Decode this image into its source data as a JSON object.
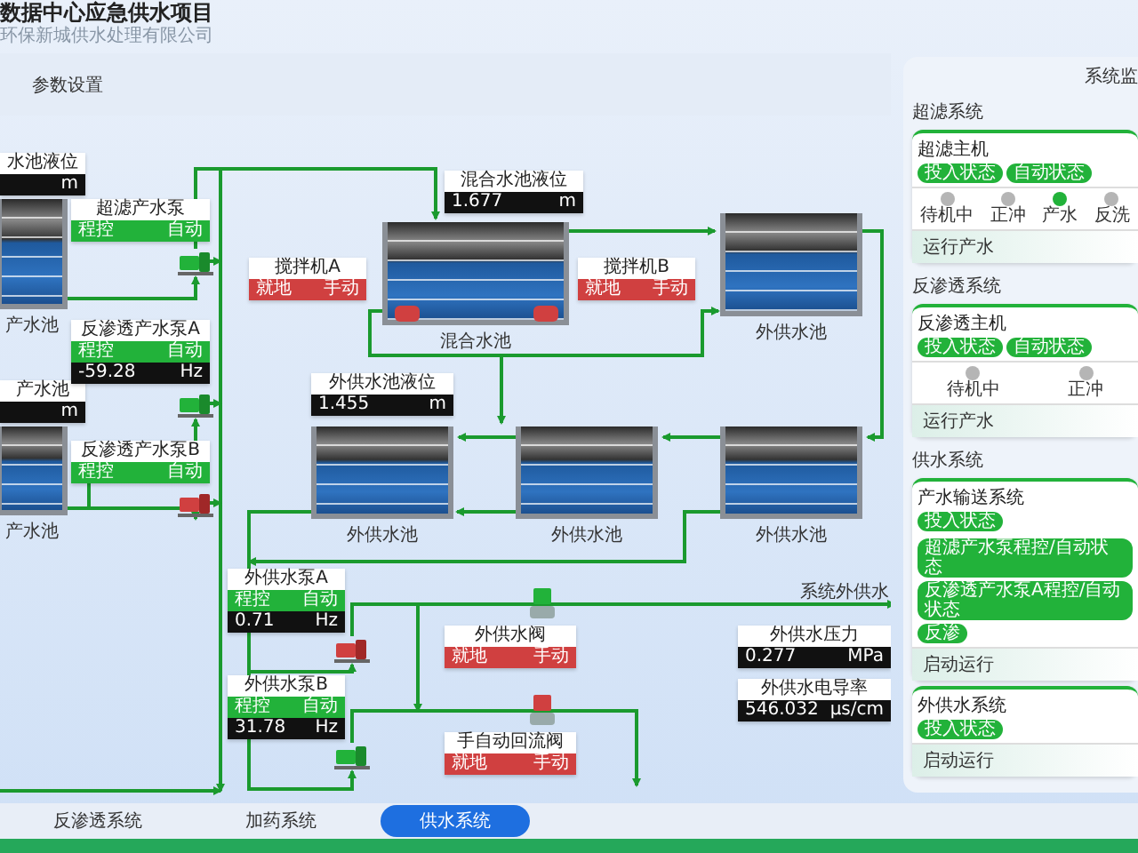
{
  "header": {
    "title": "数据中心应急供水项目",
    "subtitle": "环保新城供水处理有限公司"
  },
  "toolbar": {
    "label": "参数设置"
  },
  "diagram": {
    "tanks": [
      {
        "caption": "产水池"
      },
      {
        "caption": "混合水池"
      },
      {
        "caption": "外供水池"
      },
      {
        "caption": "产水池"
      },
      {
        "caption": "外供水池"
      },
      {
        "caption": "外供水池"
      },
      {
        "caption": "外供水池"
      }
    ],
    "level_gauges": [
      {
        "title": "水池液位",
        "unit": "m"
      },
      {
        "title": "产水池",
        "unit": "m"
      },
      {
        "title": "混合水池液位",
        "value": "1.677",
        "unit": "m"
      },
      {
        "title": "外供水池液位",
        "value": "1.455",
        "unit": "m"
      }
    ],
    "pumps": [
      {
        "title": "超滤产水泵",
        "mode": "程控",
        "control": "自动",
        "remote": true,
        "running": true
      },
      {
        "title": "反渗透产水泵A",
        "mode": "程控",
        "control": "自动",
        "remote": true,
        "reading": "-59.28",
        "unit": "Hz",
        "running": true
      },
      {
        "title": "反渗透产水泵B",
        "mode": "程控",
        "control": "自动",
        "remote": true,
        "running": false
      },
      {
        "title": "外供水泵A",
        "mode": "程控",
        "control": "自动",
        "remote": true,
        "reading": "0.71",
        "unit": "Hz",
        "running": false
      },
      {
        "title": "外供水泵B",
        "mode": "程控",
        "control": "自动",
        "remote": true,
        "reading": "31.78",
        "unit": "Hz",
        "running": true
      }
    ],
    "mixers": [
      {
        "title": "搅拌机A",
        "mode": "就地",
        "control": "手动",
        "remote": false,
        "running": false
      },
      {
        "title": "搅拌机B",
        "mode": "就地",
        "control": "手动",
        "remote": false,
        "running": false
      }
    ],
    "valves": [
      {
        "title": "外供水阀",
        "mode": "就地",
        "control": "手动",
        "remote": false,
        "open": true
      },
      {
        "title": "手自动回流阀",
        "mode": "就地",
        "control": "手动",
        "remote": false,
        "open": false
      }
    ],
    "outlet_label": "系统外供水",
    "instruments": [
      {
        "title": "外供水压力",
        "value": "0.277",
        "unit": "MPa"
      },
      {
        "title": "外供水电导率",
        "value": "546.032",
        "unit": "μs/cm"
      }
    ]
  },
  "tabs": [
    {
      "label": "反渗透系统",
      "selected": false
    },
    {
      "label": "加药系统",
      "selected": false
    },
    {
      "label": "供水系统",
      "selected": true
    }
  ],
  "panel": {
    "title": "系统监",
    "sections": [
      {
        "heading": "超滤系统",
        "cards": [
          {
            "title": "超滤主机",
            "pills": [
              "投入状态",
              "自动状态"
            ],
            "steps": [
              {
                "label": "待机中",
                "selected": false
              },
              {
                "label": "正冲",
                "selected": false
              },
              {
                "label": "产水",
                "selected": true
              },
              {
                "label": "反洗",
                "selected": false
              }
            ],
            "status": "运行产水"
          }
        ]
      },
      {
        "heading": "反渗透系统",
        "cards": [
          {
            "title": "反渗透主机",
            "pills": [
              "投入状态",
              "自动状态"
            ],
            "steps": [
              {
                "label": "待机中",
                "selected": false
              },
              {
                "label": "正冲",
                "selected": false
              }
            ],
            "status": "运行产水"
          }
        ]
      },
      {
        "heading": "供水系统",
        "cards": [
          {
            "title": "产水输送系统",
            "pills": [
              "投入状态"
            ],
            "flags": [
              "超滤产水泵程控/自动状态",
              "反渗透产水泵A程控/自动状态",
              "反渗"
            ],
            "status": "启动运行"
          },
          {
            "title": "外供水系统",
            "pills": [
              "投入状态"
            ],
            "status": "启动运行"
          }
        ]
      }
    ]
  }
}
